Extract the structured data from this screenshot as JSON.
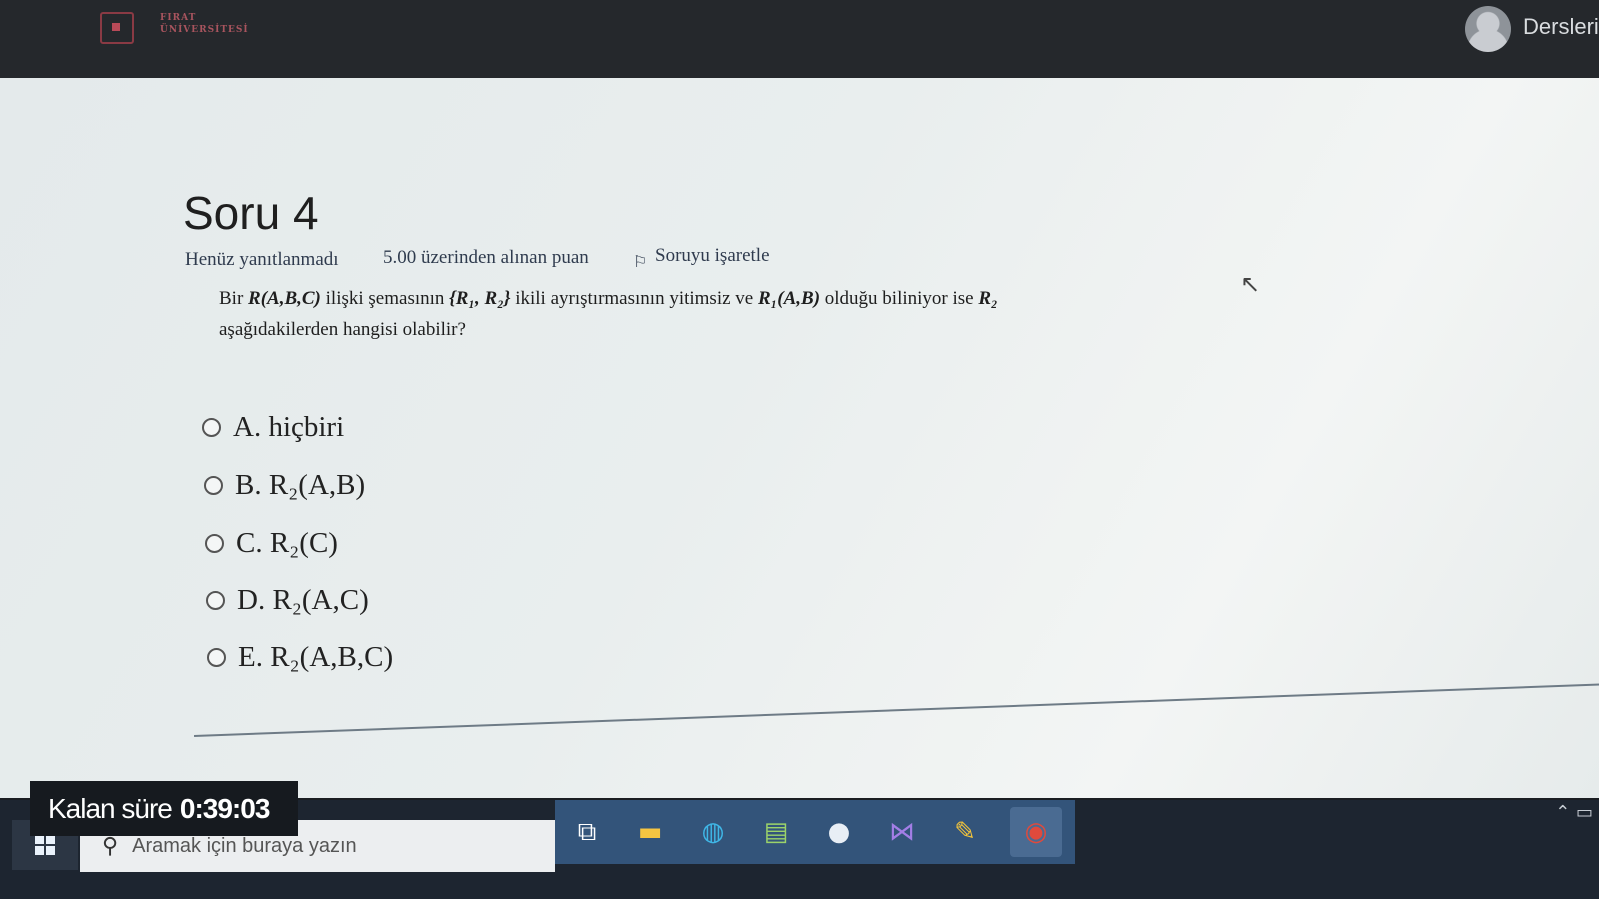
{
  "header": {
    "logo_text_line1": "FIRAT",
    "logo_text_line2": "ÜNİVERSİTESİ",
    "courses_link": "Dersleri"
  },
  "question": {
    "title": "Soru 4",
    "status": "Henüz yanıtlanmadı",
    "grade": "5.00 üzerinden alınan puan",
    "flag_label": "Soruyu işaretle",
    "text_part1": "Bir ",
    "text_schema": "R(A,B,C)",
    "text_part2": " ilişki şemasının ",
    "text_decomp": "{R₁, R₂}",
    "text_part3": " ikili ayrıştırmasının yitimsiz ve ",
    "text_r1": "R₁(A,B)",
    "text_part4": " olduğu biliniyor ise ",
    "text_r2": "R₂",
    "text_part5": " aşağıdakilerden hangisi olabilir?",
    "options": [
      {
        "label": "A. hiçbiri"
      },
      {
        "label": "B. R₂(A,B)"
      },
      {
        "label": "C. R₂(C)"
      },
      {
        "label": "D. R₂(A,C)"
      },
      {
        "label": "E. R₂(A,B,C)"
      }
    ]
  },
  "timer": {
    "label": "Kalan süre",
    "value": "0:39:03"
  },
  "taskbar": {
    "search_placeholder": "Aramak için buraya yazın",
    "icons": [
      "task-view-icon",
      "file-explorer-icon",
      "edge-icon",
      "notepad-icon",
      "chat-app-icon",
      "visual-studio-icon",
      "tool-icon",
      "chrome-icon"
    ]
  }
}
